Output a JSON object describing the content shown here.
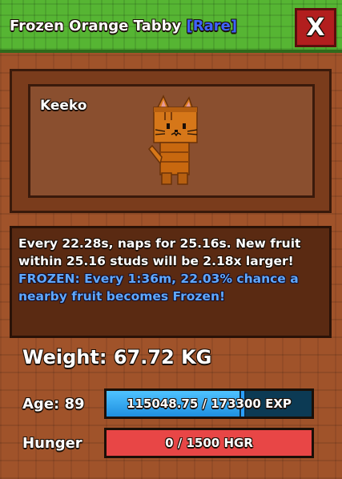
{
  "header": {
    "title": "Frozen Orange Tabby",
    "rarity": "[Rare]",
    "close_label": "X"
  },
  "pet": {
    "name": "Keeko"
  },
  "description": {
    "ability": "Every 22.28s, naps for 25.16s. New fruit within 25.16 studs will be 2.18x larger!",
    "frozen": "FROZEN: Every 1:36m, 22.03% chance a nearby fruit becomes Frozen!"
  },
  "stats": {
    "weight": "Weight: 67.72 KG",
    "age_label": "Age: 89",
    "exp_text": "115048.75 / 173300 EXP",
    "exp_fraction": 0.6639,
    "hunger_label": "Hunger",
    "hunger_text": "0 / 1500 HGR",
    "hunger_fraction": 0
  },
  "colors": {
    "rarity": "#3f63ff",
    "frozen": "#5fa8ff",
    "close": "#b21e1e",
    "exp_bar": "#2a9fff",
    "hunger_bar": "#e84646"
  },
  "icons": [
    "close-icon",
    "cat-pet-model"
  ]
}
